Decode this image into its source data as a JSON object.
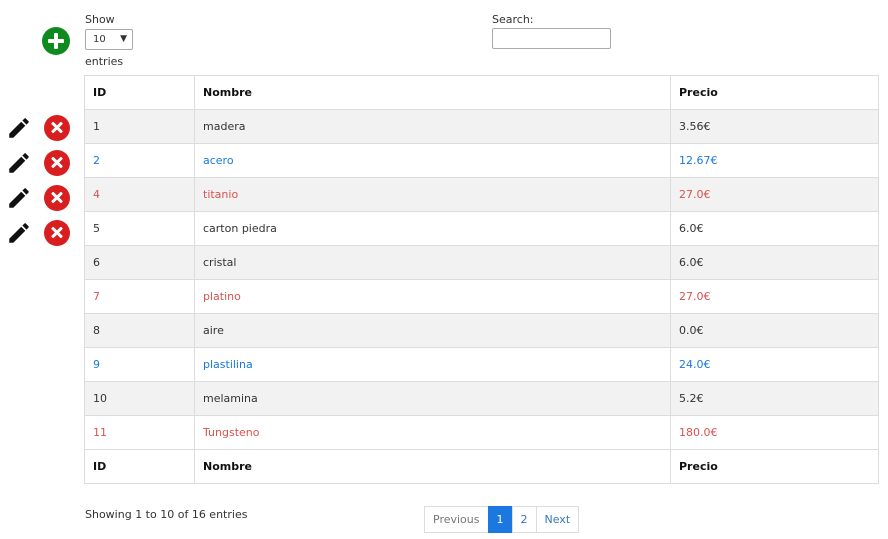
{
  "controls": {
    "show_label": "Show",
    "length_value": "10",
    "entries_label": "entries",
    "search_label": "Search:",
    "search_value": ""
  },
  "table": {
    "headers": [
      "ID",
      "Nombre",
      "Precio"
    ],
    "rows": [
      {
        "id": "1",
        "nombre": "madera",
        "precio": "3.56€",
        "color": "#333333"
      },
      {
        "id": "2",
        "nombre": "acero",
        "precio": "12.67€",
        "color": "#1a78e0"
      },
      {
        "id": "4",
        "nombre": "titanio",
        "precio": "27.0€",
        "color": "#d9534f"
      },
      {
        "id": "5",
        "nombre": "carton piedra",
        "precio": "6.0€",
        "color": "#333333"
      },
      {
        "id": "6",
        "nombre": "cristal",
        "precio": "6.0€",
        "color": "#333333"
      },
      {
        "id": "7",
        "nombre": "platino",
        "precio": "27.0€",
        "color": "#d9534f"
      },
      {
        "id": "8",
        "nombre": "aire",
        "precio": "0.0€",
        "color": "#333333"
      },
      {
        "id": "9",
        "nombre": "plastilina",
        "precio": "24.0€",
        "color": "#1a78e0"
      },
      {
        "id": "10",
        "nombre": "melamina",
        "precio": "5.2€",
        "color": "#333333"
      },
      {
        "id": "11",
        "nombre": "Tungsteno",
        "precio": "180.0€",
        "color": "#d9534f"
      }
    ]
  },
  "row_actions": {
    "count": 4,
    "edit_icon": "pencil-icon",
    "delete_icon": "delete-icon",
    "delete_color": "#d81e1e"
  },
  "add_icon": {
    "name": "add-circle-icon",
    "color": "#0f8a1f"
  },
  "footer": {
    "info": "Showing 1 to 10 of 16 entries",
    "previous": "Previous",
    "pages": [
      "1",
      "2"
    ],
    "active_page": "1",
    "next": "Next"
  }
}
